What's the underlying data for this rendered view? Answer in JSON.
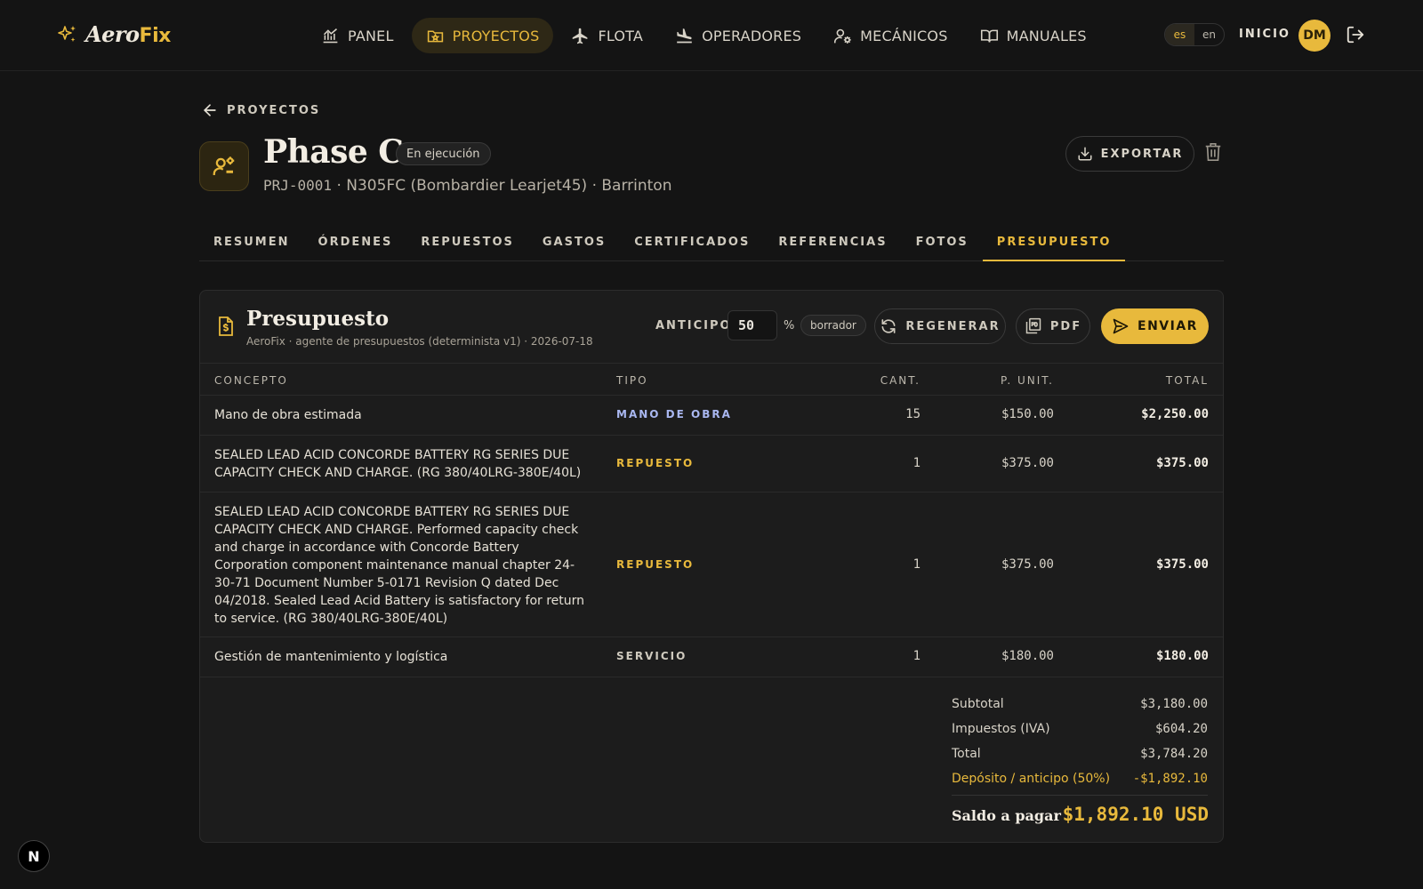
{
  "app": {
    "brand_a": "Aero",
    "brand_b": "Fix"
  },
  "nav": {
    "items": [
      {
        "label": "PANEL",
        "icon": "chart-icon"
      },
      {
        "label": "PROYECTOS",
        "icon": "folder-star-icon",
        "active": true
      },
      {
        "label": "FLOTA",
        "icon": "plane-icon"
      },
      {
        "label": "OPERADORES",
        "icon": "plane-landing-icon"
      },
      {
        "label": "MECÁNICOS",
        "icon": "user-gear-icon"
      },
      {
        "label": "MANUALES",
        "icon": "book-icon"
      }
    ],
    "lang_es": "es",
    "lang_en": "en",
    "home": "INICIO",
    "avatar": "DM"
  },
  "header": {
    "back": "PROYECTOS",
    "title": "Phase C",
    "status": "En ejecución",
    "code": "PRJ-0001",
    "subtitle": " · N305FC (Bombardier Learjet45) · Barrinton",
    "export": "EXPORTAR"
  },
  "tabs": [
    "RESUMEN",
    "ÓRDENES",
    "REPUESTOS",
    "GASTOS",
    "CERTIFICADOS",
    "REFERENCIAS",
    "FOTOS",
    "PRESUPUESTO"
  ],
  "budget": {
    "title": "Presupuesto",
    "subtitle": "AeroFix · agente de presupuestos (determinista v1) · 2026-07-18",
    "anticipo_label": "ANTICIPO",
    "anticipo_value": "50",
    "pct": "%",
    "draft": "borrador",
    "regen": "REGENERAR",
    "pdf": "PDF",
    "send": "ENVIAR",
    "columns": {
      "concept": "CONCEPTO",
      "type": "TIPO",
      "qty": "CANT.",
      "unit": "P. UNIT.",
      "total": "TOTAL"
    },
    "rows": [
      {
        "concept": "Mano de obra estimada",
        "type": "MANO DE OBRA",
        "kind": "labor",
        "qty": "15",
        "unit": "$150.00",
        "total": "$2,250.00"
      },
      {
        "concept": "SEALED LEAD ACID CONCORDE BATTERY RG SERIES DUE CAPACITY CHECK AND CHARGE. (RG 380/40LRG-380E/40L)",
        "type": "REPUESTO",
        "kind": "part",
        "qty": "1",
        "unit": "$375.00",
        "total": "$375.00"
      },
      {
        "concept": "SEALED LEAD ACID CONCORDE BATTERY RG SERIES DUE CAPACITY CHECK AND CHARGE. Performed capacity check and charge in accordance with Concorde Battery Corporation component maintenance manual chapter 24-30-71 Document Number 5-0171 Revision Q dated Dec 04/2018. Sealed Lead Acid Battery is satisfactory for return to service. (RG 380/40LRG-380E/40L)",
        "type": "REPUESTO",
        "kind": "part",
        "qty": "1",
        "unit": "$375.00",
        "total": "$375.00"
      },
      {
        "concept": "Gestión de mantenimiento y logística",
        "type": "SERVICIO",
        "kind": "service",
        "qty": "1",
        "unit": "$180.00",
        "total": "$180.00"
      }
    ],
    "totals": {
      "subtotal_label": "Subtotal",
      "subtotal": "$3,180.00",
      "tax_label": "Impuestos (IVA)",
      "tax": "$604.20",
      "total_label": "Total",
      "total": "$3,784.20",
      "deposit_label": "Depósito / anticipo (50%)",
      "deposit": "-$1,892.10",
      "balance_label": "Saldo a pagar",
      "balance": "$1,892.10 USD"
    }
  },
  "dev_badge": "N"
}
